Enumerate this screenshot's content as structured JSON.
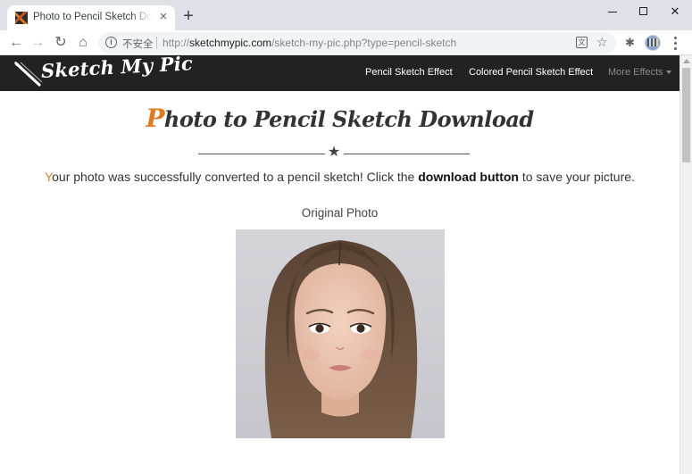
{
  "browser": {
    "tab_title": "Photo to Pencil Sketch Download",
    "new_tab_icon": "plus-icon",
    "address": {
      "security_label": "不安全",
      "url_scheme": "http://",
      "url_host": "sketchmypic.com",
      "url_path": "/sketch-my-pic.php?type=pencil-sketch"
    }
  },
  "site": {
    "logo_text": "Sketch My Pic",
    "nav": {
      "pencil": "Pencil Sketch Effect",
      "colored": "Colored Pencil Sketch Effect",
      "more": "More Effects"
    }
  },
  "page": {
    "title_first": "P",
    "title_rest": "hoto to Pencil Sketch Download",
    "message_first": "Y",
    "message_before": "our photo was successfully converted to a pencil sketch! Click the ",
    "message_bold": "download button",
    "message_after": " to save your picture.",
    "original_label": "Original Photo"
  },
  "colors": {
    "accent": "#e07b22",
    "navbar_bg": "#222222",
    "text": "#333333"
  }
}
